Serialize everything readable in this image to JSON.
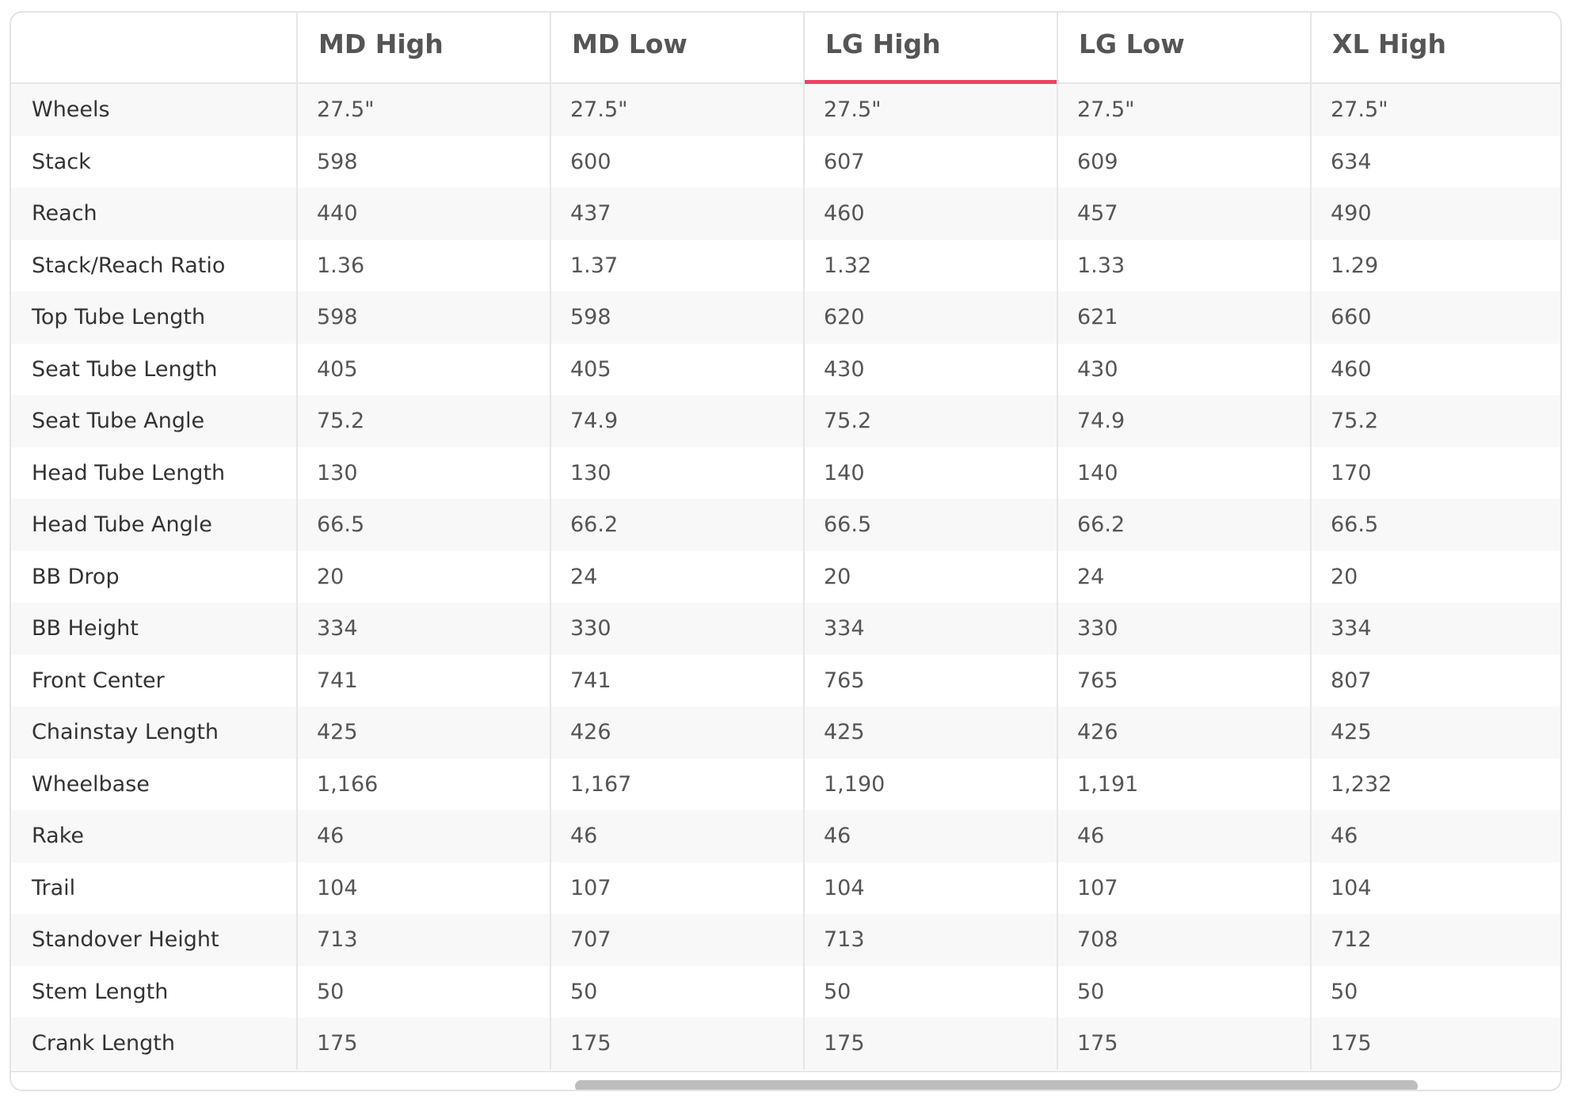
{
  "columns": [
    "",
    "MD High",
    "MD Low",
    "LG High",
    "LG Low",
    "XL High"
  ],
  "active_column": 3,
  "accent_color": "#ec4462",
  "rows": [
    {
      "label": "Wheels",
      "values": [
        "27.5\"",
        "27.5\"",
        "27.5\"",
        "27.5\"",
        "27.5\""
      ]
    },
    {
      "label": "Stack",
      "values": [
        "598",
        "600",
        "607",
        "609",
        "634"
      ]
    },
    {
      "label": "Reach",
      "values": [
        "440",
        "437",
        "460",
        "457",
        "490"
      ]
    },
    {
      "label": "Stack/Reach Ratio",
      "values": [
        "1.36",
        "1.37",
        "1.32",
        "1.33",
        "1.29"
      ]
    },
    {
      "label": "Top Tube Length",
      "values": [
        "598",
        "598",
        "620",
        "621",
        "660"
      ]
    },
    {
      "label": "Seat Tube Length",
      "values": [
        "405",
        "405",
        "430",
        "430",
        "460"
      ]
    },
    {
      "label": "Seat Tube Angle",
      "values": [
        "75.2",
        "74.9",
        "75.2",
        "74.9",
        "75.2"
      ]
    },
    {
      "label": "Head Tube Length",
      "values": [
        "130",
        "130",
        "140",
        "140",
        "170"
      ]
    },
    {
      "label": "Head Tube Angle",
      "values": [
        "66.5",
        "66.2",
        "66.5",
        "66.2",
        "66.5"
      ]
    },
    {
      "label": "BB Drop",
      "values": [
        "20",
        "24",
        "20",
        "24",
        "20"
      ]
    },
    {
      "label": "BB Height",
      "values": [
        "334",
        "330",
        "334",
        "330",
        "334"
      ]
    },
    {
      "label": "Front Center",
      "values": [
        "741",
        "741",
        "765",
        "765",
        "807"
      ]
    },
    {
      "label": "Chainstay Length",
      "values": [
        "425",
        "426",
        "425",
        "426",
        "425"
      ]
    },
    {
      "label": "Wheelbase",
      "values": [
        "1,166",
        "1,167",
        "1,190",
        "1,191",
        "1,232"
      ]
    },
    {
      "label": "Rake",
      "values": [
        "46",
        "46",
        "46",
        "46",
        "46"
      ]
    },
    {
      "label": "Trail",
      "values": [
        "104",
        "107",
        "104",
        "107",
        "104"
      ]
    },
    {
      "label": "Standover Height",
      "values": [
        "713",
        "707",
        "713",
        "708",
        "712"
      ]
    },
    {
      "label": "Stem Length",
      "values": [
        "50",
        "50",
        "50",
        "50",
        "50"
      ]
    },
    {
      "label": "Crank Length",
      "values": [
        "175",
        "175",
        "175",
        "175",
        "175"
      ]
    }
  ]
}
